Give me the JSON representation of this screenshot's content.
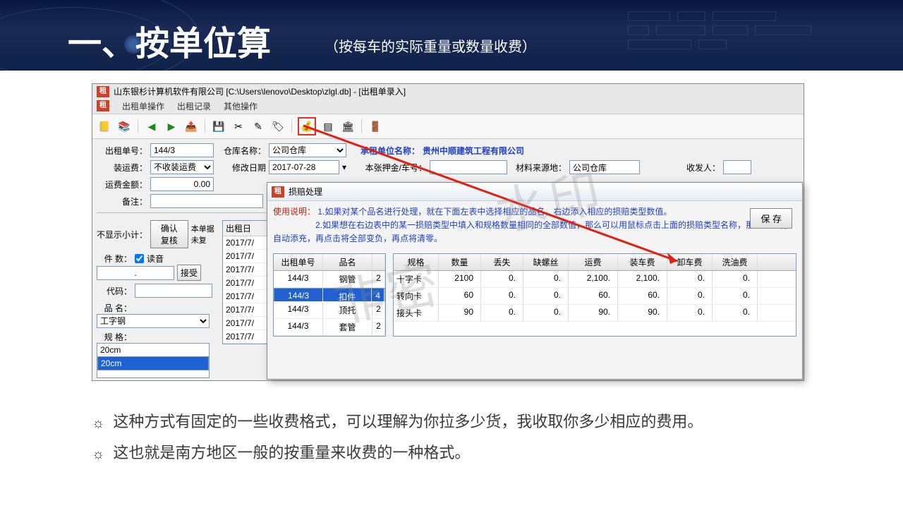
{
  "slide": {
    "title_main": "一、按单位算",
    "title_sub": "（按每车的实际重量或数量收费）",
    "bullet1": "这种方式有固定的一些收费格式，可以理解为你拉多少货，我收取你多少相应的费用。",
    "bullet2": "这也就是南方地区一般的按重量来收费的一种格式。"
  },
  "app": {
    "title": "山东银杉计算机软件有限公司    [C:\\Users\\lenovo\\Desktop\\zlgl.db] - [出租单录入]",
    "menu": [
      "出租单操作",
      "出租记录",
      "其他操作"
    ],
    "form": {
      "rental_no_lbl": "出租单号：",
      "rental_no": "144/3",
      "warehouse_lbl": "仓库名称：",
      "warehouse": "公司仓库",
      "tenant_lbl": "承租单位名称：",
      "tenant": "贵州中顺建筑工程有限公司",
      "loadfee_lbl": "装运费：",
      "loadfee": "不收装运费",
      "moddate_lbl": "修改日期",
      "moddate": "2017-07-28",
      "deposit_lbl": "本张押金/车号：",
      "source_lbl": "材料来源地：",
      "source": "公司仓库",
      "recv_lbl": "收发人：",
      "freight_lbl": "运费金额：",
      "freight": "0.00",
      "remark_lbl": "备注：",
      "nosub_lbl": "不显示小计：",
      "confirm_lbl": "确认复核",
      "undo_lbl": "本单据未复",
      "count_lbl": "件  数：",
      "read_lbl": "读音",
      "accept_lbl": "接受",
      "code_lbl": "代码：",
      "name_lbl": "品  名：",
      "name_val": "工字钢",
      "spec_lbl": "规  格：",
      "spec_rows": [
        "20cm",
        "20cm"
      ],
      "date_col_hdr": "出租日",
      "date_rows": [
        "2017/7/",
        "2017/7/",
        "2017/7/",
        "2017/7/",
        "2017/7/",
        "2017/7/",
        "2017/7/",
        "2017/7/"
      ]
    }
  },
  "popup": {
    "title": "损赔处理",
    "instr_label": "使用说明：",
    "instr1": "1.如果对某个品名进行处理，就在下面左表中选择相应的品名，右边添入相应的损赔类型数值。",
    "instr2": "2.如果想在右边表中的某一损赔类型中填入和规格数量相同的全部数值，那么可以用鼠标点击上面的损赔类型名称，那么系统将自动添充，再点击将全部变负，再点将清零。",
    "save": "保 存",
    "left_headers": [
      "出租单号",
      "品名"
    ],
    "left_rows": [
      {
        "no": "144/3",
        "name": "钢管",
        "ext": "2"
      },
      {
        "no": "144/3",
        "name": "扣件",
        "ext": "4",
        "sel": true
      },
      {
        "no": "144/3",
        "name": "顶托",
        "ext": "2"
      },
      {
        "no": "144/3",
        "name": "套管",
        "ext": "2"
      }
    ],
    "right_headers": [
      "规格",
      "数量",
      "丢失",
      "缺螺丝",
      "运费",
      "装车费",
      "卸车费",
      "洗油费"
    ],
    "right_rows": [
      {
        "spec": "十字卡",
        "qty": "2100",
        "lost": "0.",
        "screw": "0.",
        "ship": "2,100.",
        "load": "2,100.",
        "unload": "0.",
        "oil": "0."
      },
      {
        "spec": "转向卡",
        "qty": "60",
        "lost": "0.",
        "screw": "0.",
        "ship": "60.",
        "load": "60.",
        "unload": "0.",
        "oil": "0."
      },
      {
        "spec": "接头卡",
        "qty": "90",
        "lost": "0.",
        "screw": "0.",
        "ship": "90.",
        "load": "90.",
        "unload": "0.",
        "oil": "0."
      }
    ]
  },
  "watermark": "非密",
  "watermark2": "水印"
}
